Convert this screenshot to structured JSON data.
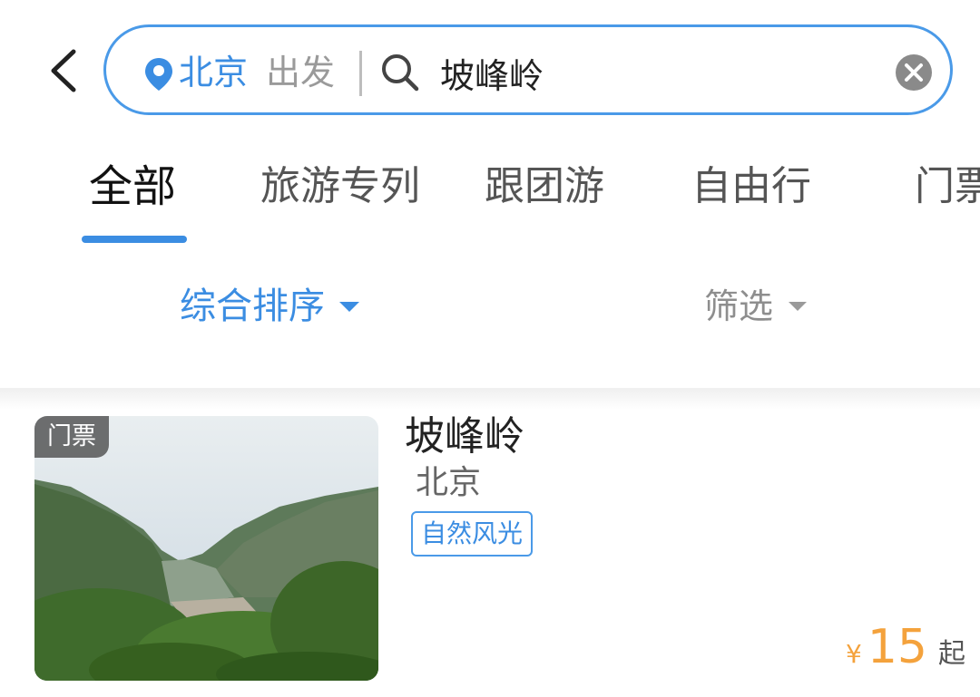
{
  "search": {
    "city": "北京",
    "depart_label": "出发",
    "query": "坡峰岭",
    "icons": {
      "location": "location-pin-icon",
      "search": "search-icon",
      "clear": "clear-icon",
      "back": "chevron-left-icon"
    }
  },
  "tabs": [
    {
      "label": "全部",
      "active": true
    },
    {
      "label": "旅游专列",
      "active": false
    },
    {
      "label": "跟团游",
      "active": false
    },
    {
      "label": "自由行",
      "active": false
    },
    {
      "label": "门票",
      "active": false
    }
  ],
  "sort": {
    "label": "综合排序",
    "icon": "caret-down-icon"
  },
  "filter": {
    "label": "筛选",
    "icon": "caret-down-icon"
  },
  "results": [
    {
      "badge": "门票",
      "title": "坡峰岭",
      "city": "北京",
      "tag": "自然风光",
      "price": {
        "symbol": "¥",
        "value": "15",
        "suffix": "起"
      }
    }
  ],
  "colors": {
    "accent": "#3b8de2",
    "search_border": "#4a9ae8",
    "price": "#f4a23c",
    "text_primary": "#222222",
    "text_muted": "#8e8e8e"
  }
}
